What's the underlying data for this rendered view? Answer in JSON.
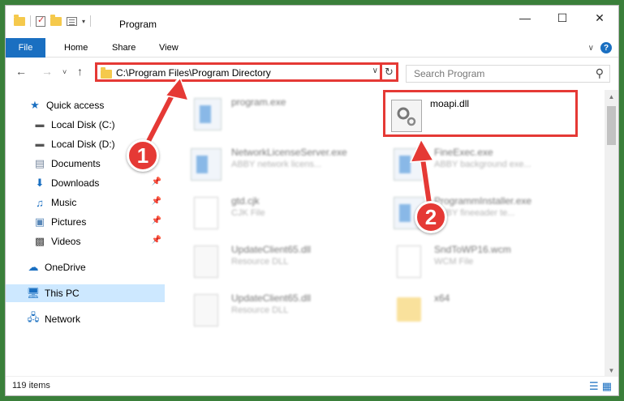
{
  "window": {
    "title": "Program"
  },
  "ribbon": {
    "tabs": [
      "File",
      "Home",
      "Share",
      "View"
    ],
    "help_label": "?"
  },
  "address": {
    "path": "C:\\Program Files\\Program Directory",
    "search_placeholder": "Search Program"
  },
  "sidebar": {
    "items": [
      {
        "label": "Quick access",
        "icon": "star-icon"
      },
      {
        "label": "Local Disk (C:)",
        "icon": "drive-icon"
      },
      {
        "label": "Local Disk (D:)",
        "icon": "drive-icon"
      },
      {
        "label": "Documents",
        "icon": "documents-icon"
      },
      {
        "label": "Downloads",
        "icon": "download-icon"
      },
      {
        "label": "Music",
        "icon": "music-icon"
      },
      {
        "label": "Pictures",
        "icon": "pictures-icon"
      },
      {
        "label": "Videos",
        "icon": "video-icon"
      },
      {
        "label": "OneDrive",
        "icon": "cloud-icon"
      },
      {
        "label": "This PC",
        "icon": "computer-icon"
      },
      {
        "label": "Network",
        "icon": "network-icon"
      }
    ]
  },
  "files": [
    {
      "name": "program.exe",
      "desc": ""
    },
    {
      "name": "moapi.dll",
      "desc": ""
    },
    {
      "name": "NetworkLicenseServer.exe",
      "desc": "ABBY network licens..."
    },
    {
      "name": "FineExec.exe",
      "desc": "ABBY background exe..."
    },
    {
      "name": "gtd.cjk",
      "desc": "CJK File"
    },
    {
      "name": "ProgrammInstaller.exe",
      "desc": "ABBY fineeader te..."
    },
    {
      "name": "UpdateClient65.dll",
      "desc": "Resource DLL"
    },
    {
      "name": "SndToWP16.wcm",
      "desc": "WCM File"
    },
    {
      "name": "UpdateClient65.dll",
      "desc": "Resource DLL"
    },
    {
      "name": "x64",
      "desc": ""
    }
  ],
  "status": {
    "count": "119 items"
  },
  "callouts": {
    "one": "1",
    "two": "2"
  },
  "colors": {
    "accent": "#1a6fc1",
    "highlight": "#e53935",
    "selected": "#cde8ff"
  }
}
